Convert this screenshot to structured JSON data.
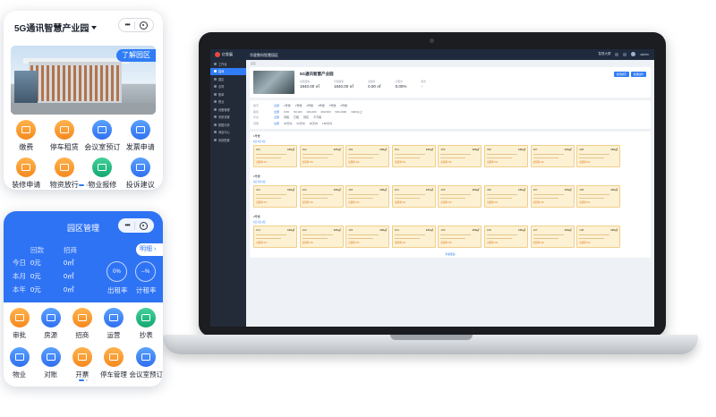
{
  "laptop": {
    "app_name": "亿发展",
    "top_title": "华夏数科智慧园区",
    "top_right": [
      "智慧大屏",
      "admin"
    ],
    "sidebar": [
      "工作台",
      "招商",
      "园区",
      "合同",
      "账单",
      "物业",
      "设备管理",
      "系统设置",
      "数据分析",
      "消息中心",
      "系统配置"
    ],
    "breadcrumb": "园区",
    "park": {
      "name": "5G通讯智慧产业园",
      "stats": [
        {
          "label": "在租面积",
          "value": "1840.00 ㎡"
        },
        {
          "label": "待租面积",
          "value": "1840.00 ㎡"
        },
        {
          "label": "出租率",
          "value": "0.00 ㎡"
        },
        {
          "label": "计租率",
          "value": "0.00%"
        },
        {
          "label": "租金",
          "value": "-"
        }
      ],
      "buttons": [
        "新增楼宇",
        "批量操作"
      ]
    },
    "filters": [
      {
        "label": "楼宇",
        "options": [
          "全部",
          "1号楼",
          "2号楼",
          "3号楼",
          "4号楼",
          "5号楼",
          "6号楼"
        ]
      },
      {
        "label": "面积",
        "options": [
          "全部",
          "0-50",
          "50-100",
          "100-200",
          "200-500",
          "500-1000",
          "1000以上"
        ]
      },
      {
        "label": "状态",
        "options": [
          "全部",
          "待租",
          "已租",
          "预定",
          "不可租"
        ]
      },
      {
        "label": "到期",
        "options": [
          "全部",
          "30天内",
          "60天内",
          "90天内",
          "180天内"
        ]
      }
    ],
    "floors": [
      {
        "name": "1号楼",
        "sub": "1层 2层 3层",
        "units": [
          {
            "no": "301",
            "area": "120㎡",
            "tag": "出租率 0%"
          },
          {
            "no": "302",
            "area": "120㎡",
            "tag": "出租率 0%"
          },
          {
            "no": "303",
            "area": "120㎡",
            "tag": "出租率 0%"
          },
          {
            "no": "304",
            "area": "120㎡",
            "tag": "出租率 0%"
          },
          {
            "no": "305",
            "area": "120㎡",
            "tag": "出租率 0%"
          },
          {
            "no": "306",
            "area": "120㎡",
            "tag": "出租率 0%"
          },
          {
            "no": "307",
            "area": "120㎡",
            "tag": "出租率 0%"
          },
          {
            "no": "308",
            "area": "120㎡",
            "tag": "出租率 0%"
          }
        ]
      },
      {
        "name": "1号楼",
        "sub": "4层 5层 6层",
        "units": [
          {
            "no": "401",
            "area": "120㎡",
            "tag": "出租率 0%"
          },
          {
            "no": "402",
            "area": "120㎡",
            "tag": "出租率 0%"
          },
          {
            "no": "403",
            "area": "120㎡",
            "tag": "出租率 0%"
          },
          {
            "no": "404",
            "area": "120㎡",
            "tag": "出租率 0%"
          },
          {
            "no": "405",
            "area": "120㎡",
            "tag": "出租率 0%"
          },
          {
            "no": "406",
            "area": "120㎡",
            "tag": "出租率 0%"
          },
          {
            "no": "407",
            "area": "120㎡",
            "tag": "出租率 0%"
          },
          {
            "no": "408",
            "area": "120㎡",
            "tag": "出租率 0%"
          }
        ]
      },
      {
        "name": "2号楼",
        "sub": "1层 2层 3层",
        "units": [
          {
            "no": "101",
            "area": "120㎡",
            "tag": "出租率 0%"
          },
          {
            "no": "102",
            "area": "120㎡",
            "tag": "出租率 0%"
          },
          {
            "no": "103",
            "area": "120㎡",
            "tag": "出租率 0%"
          },
          {
            "no": "104",
            "area": "120㎡",
            "tag": "出租率 0%"
          },
          {
            "no": "105",
            "area": "120㎡",
            "tag": "出租率 0%"
          },
          {
            "no": "106",
            "area": "120㎡",
            "tag": "出租率 0%"
          },
          {
            "no": "107",
            "area": "120㎡",
            "tag": "出租率 0%"
          },
          {
            "no": "108",
            "area": "120㎡",
            "tag": "出租率 0%"
          }
        ]
      }
    ],
    "more": "查看更多"
  },
  "phone1": {
    "title": "5G通讯智慧产业园",
    "chip": "了解园区",
    "icons": [
      {
        "label": "缴费",
        "icon": "wallet-icon",
        "color": "orange"
      },
      {
        "label": "停车租赁",
        "icon": "parking-icon",
        "color": "orange"
      },
      {
        "label": "会议室预订",
        "icon": "meeting-room-icon",
        "color": "blue"
      },
      {
        "label": "发票申请",
        "icon": "invoice-icon",
        "color": "blue"
      },
      {
        "label": "装修申请",
        "icon": "renovation-icon",
        "color": "orange"
      },
      {
        "label": "物资放行",
        "icon": "goods-release-icon",
        "color": "orange"
      },
      {
        "label": "物业报修",
        "icon": "repair-icon",
        "color": "green"
      },
      {
        "label": "投诉建议",
        "icon": "feedback-icon",
        "color": "blue"
      }
    ]
  },
  "phone2": {
    "title": "园区管理",
    "columns": [
      "回款",
      "招商"
    ],
    "rows": [
      {
        "label": "今日",
        "a": "0元",
        "b": "0㎡"
      },
      {
        "label": "本月",
        "a": "0元",
        "b": "0㎡"
      },
      {
        "label": "本年",
        "a": "0元",
        "b": "0㎡"
      }
    ],
    "detail": "明细 ›",
    "rings": [
      {
        "value": "0%",
        "label": "出租率"
      },
      {
        "value": "--%",
        "label": "计租率"
      }
    ],
    "icons": [
      {
        "label": "审批",
        "icon": "approval-icon",
        "color": "orange"
      },
      {
        "label": "房源",
        "icon": "listing-icon",
        "color": "blue"
      },
      {
        "label": "招商",
        "icon": "recruit-icon",
        "color": "orange"
      },
      {
        "label": "运营",
        "icon": "operation-icon",
        "color": "blue"
      },
      {
        "label": "抄表",
        "icon": "meter-icon",
        "color": "green"
      },
      {
        "label": "物业",
        "icon": "property-icon",
        "color": "blue"
      },
      {
        "label": "对账",
        "icon": "reconcile-icon",
        "color": "blue"
      },
      {
        "label": "开票",
        "icon": "invoice-icon",
        "color": "orange"
      },
      {
        "label": "停车管理",
        "icon": "parking-icon",
        "color": "orange"
      },
      {
        "label": "会议室预订",
        "icon": "meeting-room-icon",
        "color": "blue"
      }
    ]
  },
  "colors": {
    "primary": "#2f73f5",
    "orange": "#f58a1f",
    "green": "#14a871",
    "unit_bg": "#fdf1d4"
  }
}
